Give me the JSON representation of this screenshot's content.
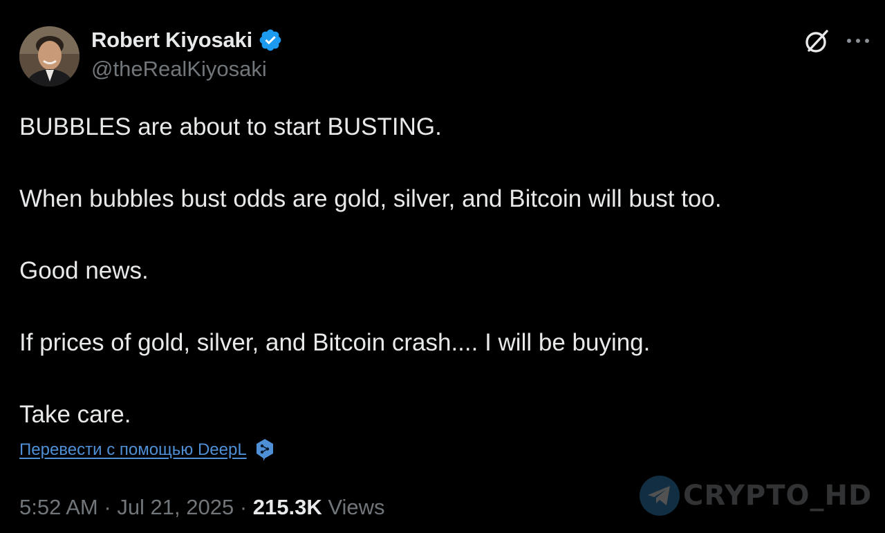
{
  "author": {
    "display_name": "Robert Kiyosaki",
    "handle": "@theRealKiyosaki",
    "verified": true,
    "verified_color": "#1d9bf0"
  },
  "header_icons": {
    "grok": "grok-icon",
    "more": "more-options-icon"
  },
  "tweet": {
    "paragraphs": [
      "BUBBLES are about to start BUSTING.",
      "When bubbles bust odds are gold, silver, and Bitcoin will bust too.",
      "Good news.",
      "If prices of gold, silver, and Bitcoin crash.... I will be buying.",
      "Take care."
    ]
  },
  "translate": {
    "label": "Перевести с помощью DeepL",
    "icon": "deepl-icon",
    "color": "#4f8fd6"
  },
  "meta": {
    "time": "5:52 AM",
    "separator": " · ",
    "date": "Jul 21, 2025",
    "views_count": "215.3K",
    "views_label": "Views"
  },
  "watermark": {
    "text": "CRYPTO_HD",
    "icon": "telegram-icon"
  },
  "colors": {
    "background": "#000000",
    "primary_text": "#e7e9ea",
    "secondary_text": "#71767b"
  }
}
